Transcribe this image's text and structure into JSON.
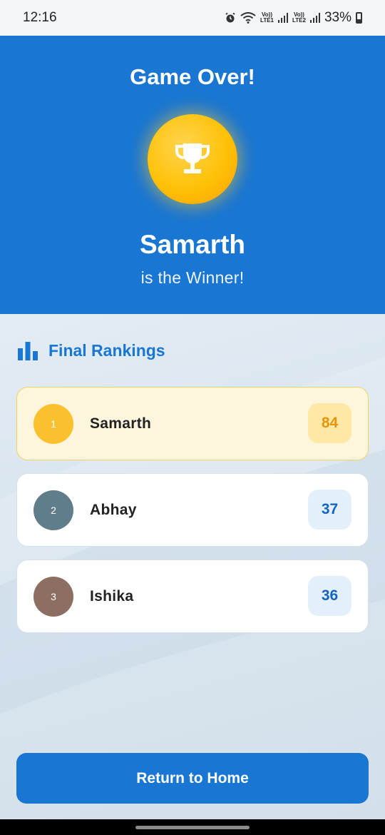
{
  "status_bar": {
    "time": "12:16",
    "lte1_top": "Vo))",
    "lte1_bottom": "LTE1",
    "lte2_top": "Vo))",
    "lte2_bottom": "LTE2",
    "battery": "33%"
  },
  "header": {
    "title": "Game Over!",
    "icon": "trophy-icon",
    "winner_name": "Samarth",
    "winner_subtitle": "is the Winner!"
  },
  "rankings": {
    "heading": "Final Rankings",
    "icon": "bar-chart-icon",
    "players": [
      {
        "rank": "1",
        "name": "Samarth",
        "score": "84",
        "badge_color": "#fbc02d"
      },
      {
        "rank": "2",
        "name": "Abhay",
        "score": "37",
        "badge_color": "#607d8b"
      },
      {
        "rank": "3",
        "name": "Ishika",
        "score": "36",
        "badge_color": "#8d6e63"
      }
    ]
  },
  "actions": {
    "return_home_label": "Return to Home"
  },
  "colors": {
    "primary": "#1976d2",
    "gold": "#ffc107",
    "first_card_bg": "#fdf6dd"
  }
}
